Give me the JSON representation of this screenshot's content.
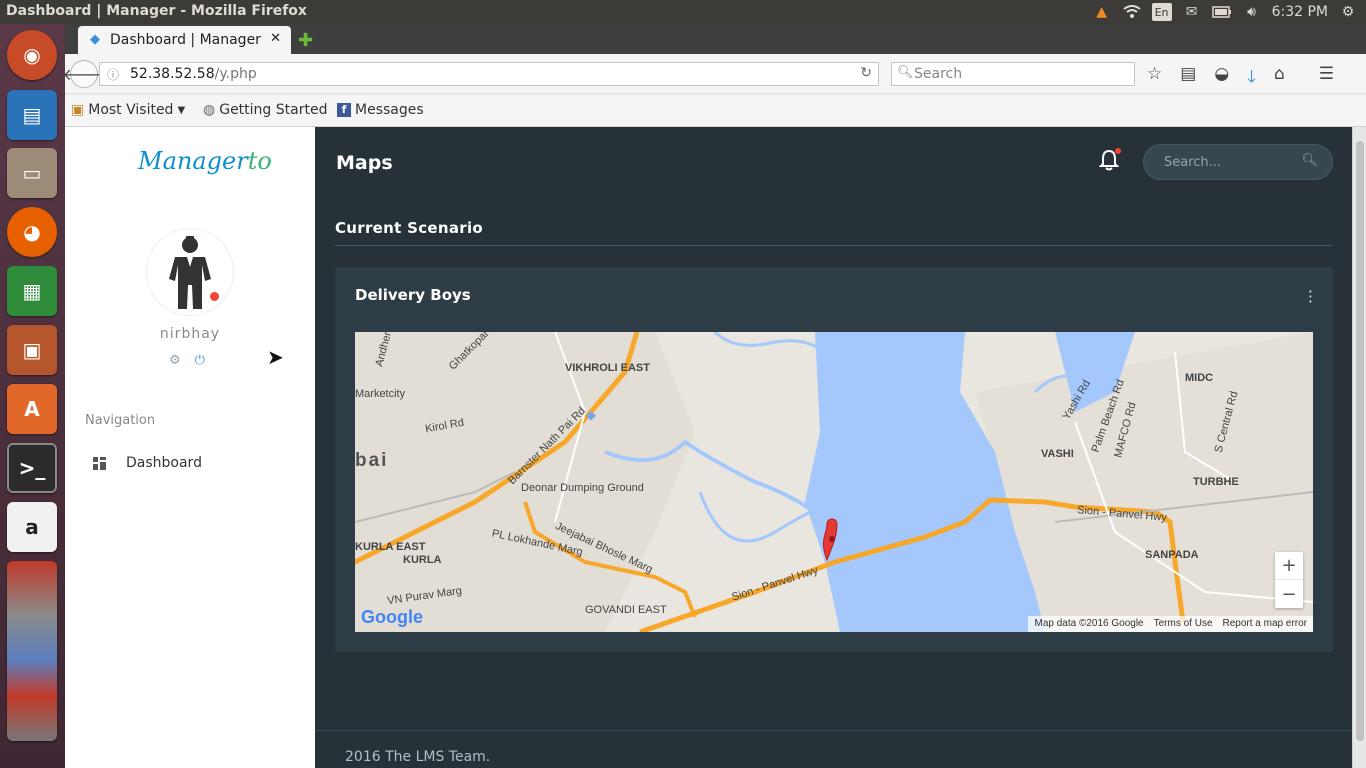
{
  "os": {
    "window_title": "Dashboard | Manager - Mozilla Firefox",
    "tray": {
      "keyboard": "En",
      "time": "6:32 PM"
    }
  },
  "browser": {
    "tab_title": "Dashboard | Manager",
    "url_host": "52.38.52.58",
    "url_path": "/y.php",
    "search_placeholder": "Search",
    "bookmarks": [
      "Most Visited",
      "Getting Started",
      "Messages"
    ]
  },
  "sidebar": {
    "brand_part1": "Manager",
    "brand_part2": "to",
    "username": "nirbhay",
    "nav_heading": "Navigation",
    "nav_items": [
      {
        "label": "Dashboard",
        "icon": "dashboard-icon"
      }
    ]
  },
  "main": {
    "page_title": "Maps",
    "search_placeholder": "Search...",
    "section_title": "Current Scenario",
    "card_title": "Delivery Boys",
    "footer": "2016 The LMS Team."
  },
  "map": {
    "labels": [
      "Ghatkopar Rd",
      "VIKHROLI EAST",
      "Marketcity",
      "Kirol Rd",
      "Barnster Nath Pai Rd",
      "bai",
      "Deonar Dumping Ground",
      "KURLA EAST",
      "KURLA",
      "PL Lokhande Marg",
      "Jeejabai Bhosle Marg",
      "VN Purav Marg",
      "GOVANDI EAST",
      "Sion - Panvel Hwy",
      "MIDC",
      "VASHI",
      "Palm Beach Rd",
      "TURBHE",
      "SANPADA",
      "S Central Rd",
      "Yashi Rd",
      "MAFCO Rd",
      "Andheri"
    ],
    "attribution": [
      "Map data ©2016 Google",
      "Terms of Use",
      "Report a map error"
    ],
    "zoom_in": "+",
    "zoom_out": "−",
    "logo": "Google"
  },
  "colors": {
    "accent_blue": "#0d8fd0",
    "page_bg": "#263238",
    "card_bg": "#2e3d45",
    "status_red": "#f44336"
  }
}
